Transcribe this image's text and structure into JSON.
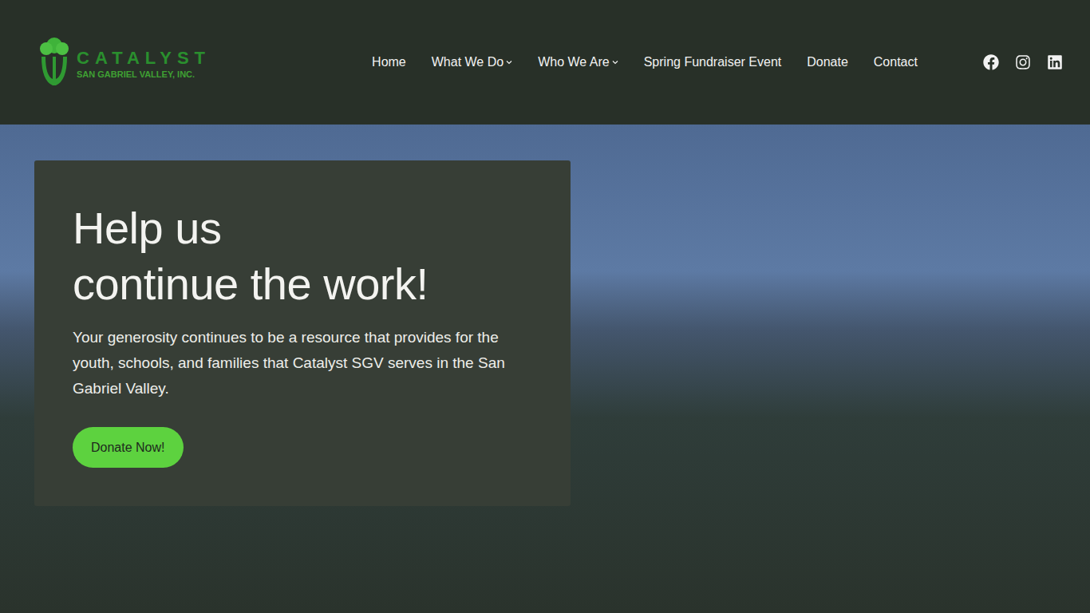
{
  "logo": {
    "name": "CATALYST",
    "subtitle": "SAN GABRIEL VALLEY, INC."
  },
  "nav": [
    {
      "label": "Home",
      "dropdown": false
    },
    {
      "label": "What We Do",
      "dropdown": true
    },
    {
      "label": "Who We Are",
      "dropdown": true
    },
    {
      "label": "Spring Fundraiser Event",
      "dropdown": false
    },
    {
      "label": "Donate",
      "dropdown": false
    },
    {
      "label": "Contact",
      "dropdown": false
    }
  ],
  "hero": {
    "heading": [
      "Help us",
      "continue the work!"
    ],
    "text": "Your generosity continues to be a resource that provides for the youth, schools, and families that Catalyst SGV serves in the San Gabriel Valley.",
    "button": "Donate Now!"
  }
}
